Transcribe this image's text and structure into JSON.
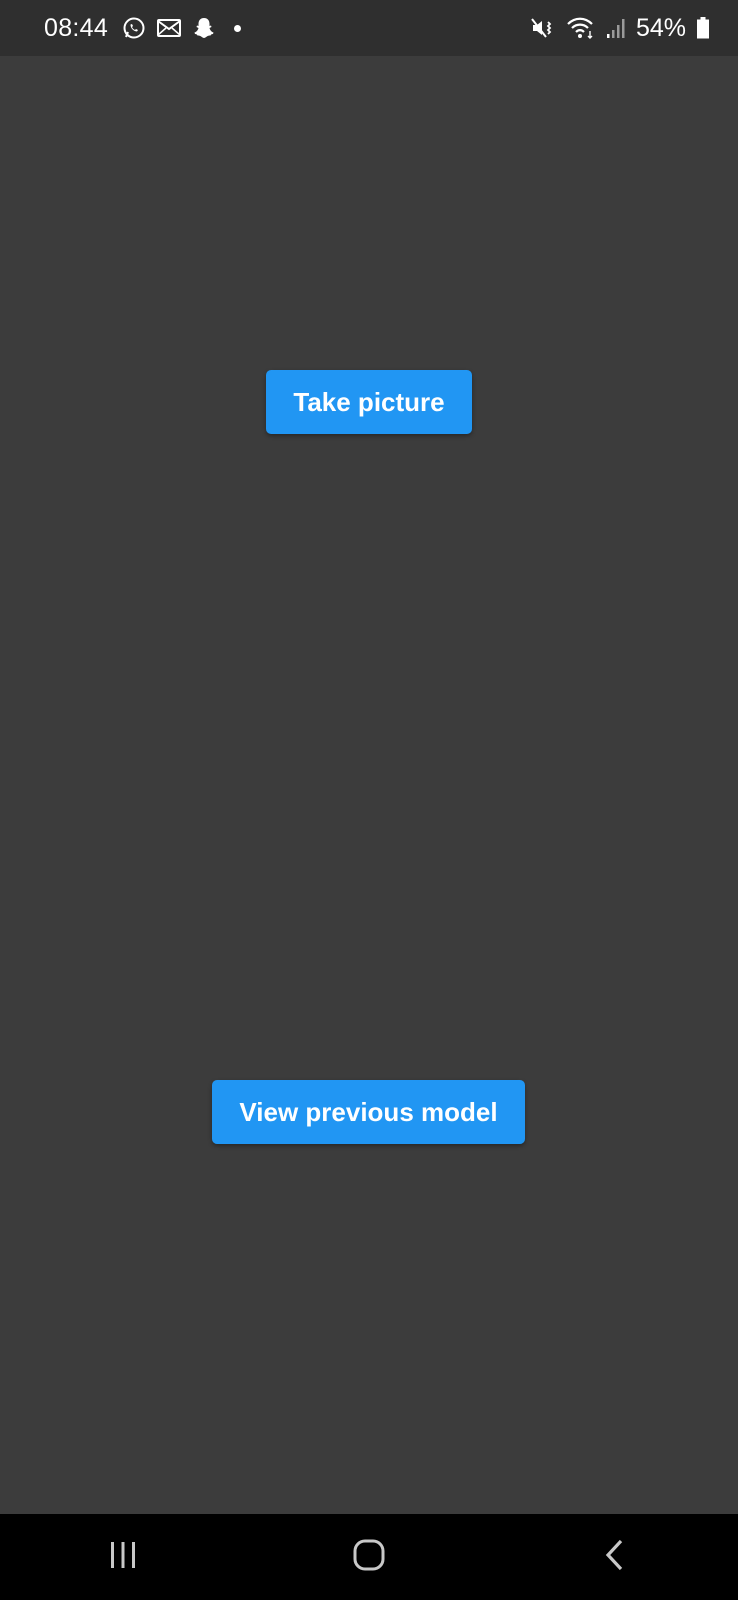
{
  "status_bar": {
    "time": "08:44",
    "notification_icons": [
      "whatsapp-icon",
      "mail-icon",
      "snapchat-icon",
      "more-notifications-dot"
    ],
    "system_icons": [
      "mute-vibrate-icon",
      "wifi-icon",
      "signal-icon",
      "battery-icon"
    ],
    "battery_percent": "54%"
  },
  "main": {
    "take_picture_label": "Take picture",
    "view_previous_label": "View previous model"
  },
  "nav_bar": {
    "recent_apps": "recent-apps-icon",
    "home": "home-icon",
    "back": "back-icon"
  },
  "colors": {
    "background": "#3c3c3c",
    "status_bar": "#2f2f2f",
    "nav_bar": "#000000",
    "button": "#2196f3",
    "button_text": "#ffffff"
  }
}
